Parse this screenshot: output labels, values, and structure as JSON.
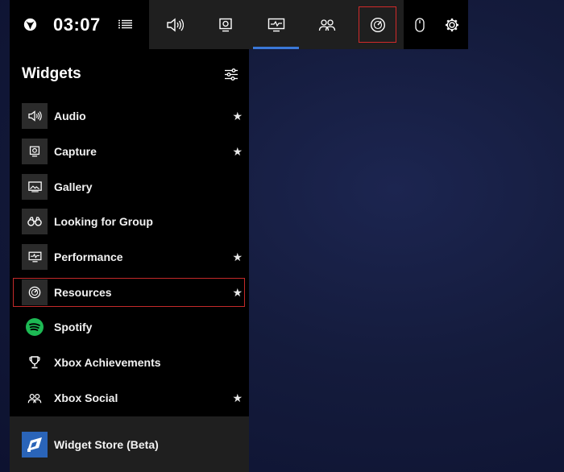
{
  "topbar": {
    "clock": "03:07",
    "tools": [
      {
        "name": "audio-tool-button",
        "icon": "speaker-icon"
      },
      {
        "name": "capture-tool-button",
        "icon": "capture-icon"
      },
      {
        "name": "performance-tool-button",
        "icon": "performance-icon",
        "active": true
      },
      {
        "name": "social-tool-button",
        "icon": "people-icon"
      },
      {
        "name": "resources-tool-button",
        "icon": "gauge-icon",
        "highlighted": true
      }
    ]
  },
  "panel": {
    "title": "Widgets",
    "items": [
      {
        "label": "Audio",
        "icon": "speaker-icon",
        "favorite": true
      },
      {
        "label": "Capture",
        "icon": "capture-icon",
        "favorite": true
      },
      {
        "label": "Gallery",
        "icon": "gallery-icon",
        "favorite": false
      },
      {
        "label": "Looking for Group",
        "icon": "binoculars-icon",
        "favorite": false
      },
      {
        "label": "Performance",
        "icon": "performance-icon",
        "favorite": true
      },
      {
        "label": "Resources",
        "icon": "gauge-icon",
        "favorite": true,
        "highlighted": true
      },
      {
        "label": "Spotify",
        "icon": "spotify-icon",
        "favorite": false
      },
      {
        "label": "Xbox Achievements",
        "icon": "trophy-icon",
        "favorite": false
      },
      {
        "label": "Xbox Social",
        "icon": "people-icon",
        "favorite": true
      }
    ],
    "star": "★"
  },
  "store": {
    "label": "Widget Store (Beta)"
  },
  "colors": {
    "accent": "#3a78d8",
    "highlight": "#d22a2a",
    "spotify": "#1db954",
    "store_icon": "#2a64b8"
  }
}
